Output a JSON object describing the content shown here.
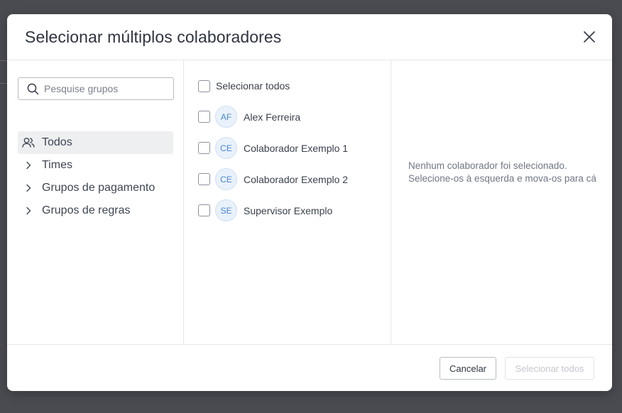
{
  "modal": {
    "title": "Selecionar múltiplos colaboradores",
    "close_icon": "close-icon"
  },
  "search": {
    "placeholder": "Pesquise grupos",
    "icon": "search-icon"
  },
  "groups": [
    {
      "label": "Todos",
      "icon": "users-icon",
      "active": true
    },
    {
      "label": "Times",
      "icon": "chevron-right-icon",
      "active": false
    },
    {
      "label": "Grupos de pagamento",
      "icon": "chevron-right-icon",
      "active": false
    },
    {
      "label": "Grupos de regras",
      "icon": "chevron-right-icon",
      "active": false
    }
  ],
  "collaborators": {
    "select_all_label": "Selecionar todos",
    "items": [
      {
        "initials": "AF",
        "name": "Alex Ferreira"
      },
      {
        "initials": "CE",
        "name": "Colaborador Exemplo 1"
      },
      {
        "initials": "CE",
        "name": "Colaborador Exemplo 2"
      },
      {
        "initials": "SE",
        "name": "Supervisor Exemplo"
      }
    ]
  },
  "selected_panel": {
    "empty_line1": "Nenhum colaborador foi selecionado.",
    "empty_line2": "Selecione-os à esquerda e mova-os para cá"
  },
  "footer": {
    "cancel_label": "Cancelar",
    "select_all_label": "Selecionar todos"
  },
  "colors": {
    "accent": "#4a86cf",
    "backdrop": "#4a4b51"
  }
}
